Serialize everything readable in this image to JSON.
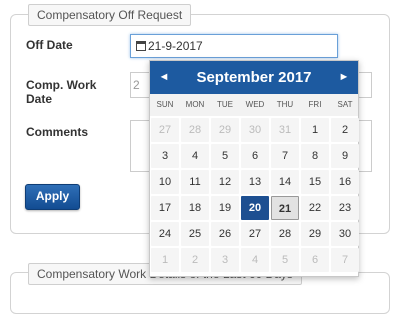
{
  "form": {
    "legend": "Compensatory Off Request",
    "off_date_label": "Off Date",
    "off_date_value": "21-9-2017",
    "comp_work_date_label": "Comp. Work Date",
    "comp_work_date_value": "2",
    "comments_label": "Comments",
    "apply_label": "Apply"
  },
  "section2": {
    "legend": "Compensatory Work Details of the Last 60 Days"
  },
  "datepicker": {
    "title": "September 2017",
    "prev": "◄",
    "next": "►",
    "dows": [
      "SUN",
      "MON",
      "TUE",
      "WED",
      "THU",
      "FRI",
      "SAT"
    ],
    "weeks": [
      [
        {
          "d": "27",
          "m": 1
        },
        {
          "d": "28",
          "m": 1
        },
        {
          "d": "29",
          "m": 1
        },
        {
          "d": "30",
          "m": 1
        },
        {
          "d": "31",
          "m": 1
        },
        {
          "d": "1"
        },
        {
          "d": "2"
        }
      ],
      [
        {
          "d": "3"
        },
        {
          "d": "4"
        },
        {
          "d": "5"
        },
        {
          "d": "6"
        },
        {
          "d": "7"
        },
        {
          "d": "8"
        },
        {
          "d": "9"
        }
      ],
      [
        {
          "d": "10"
        },
        {
          "d": "11"
        },
        {
          "d": "12"
        },
        {
          "d": "13"
        },
        {
          "d": "14"
        },
        {
          "d": "15"
        },
        {
          "d": "16"
        }
      ],
      [
        {
          "d": "17"
        },
        {
          "d": "18"
        },
        {
          "d": "19"
        },
        {
          "d": "20",
          "s": 1
        },
        {
          "d": "21",
          "t": 1
        },
        {
          "d": "22"
        },
        {
          "d": "23"
        }
      ],
      [
        {
          "d": "24"
        },
        {
          "d": "25"
        },
        {
          "d": "26"
        },
        {
          "d": "27"
        },
        {
          "d": "28"
        },
        {
          "d": "29"
        },
        {
          "d": "30"
        }
      ],
      [
        {
          "d": "1",
          "m": 1
        },
        {
          "d": "2",
          "m": 1
        },
        {
          "d": "3",
          "m": 1
        },
        {
          "d": "4",
          "m": 1
        },
        {
          "d": "5",
          "m": 1
        },
        {
          "d": "6",
          "m": 1
        },
        {
          "d": "7",
          "m": 1
        }
      ]
    ]
  }
}
